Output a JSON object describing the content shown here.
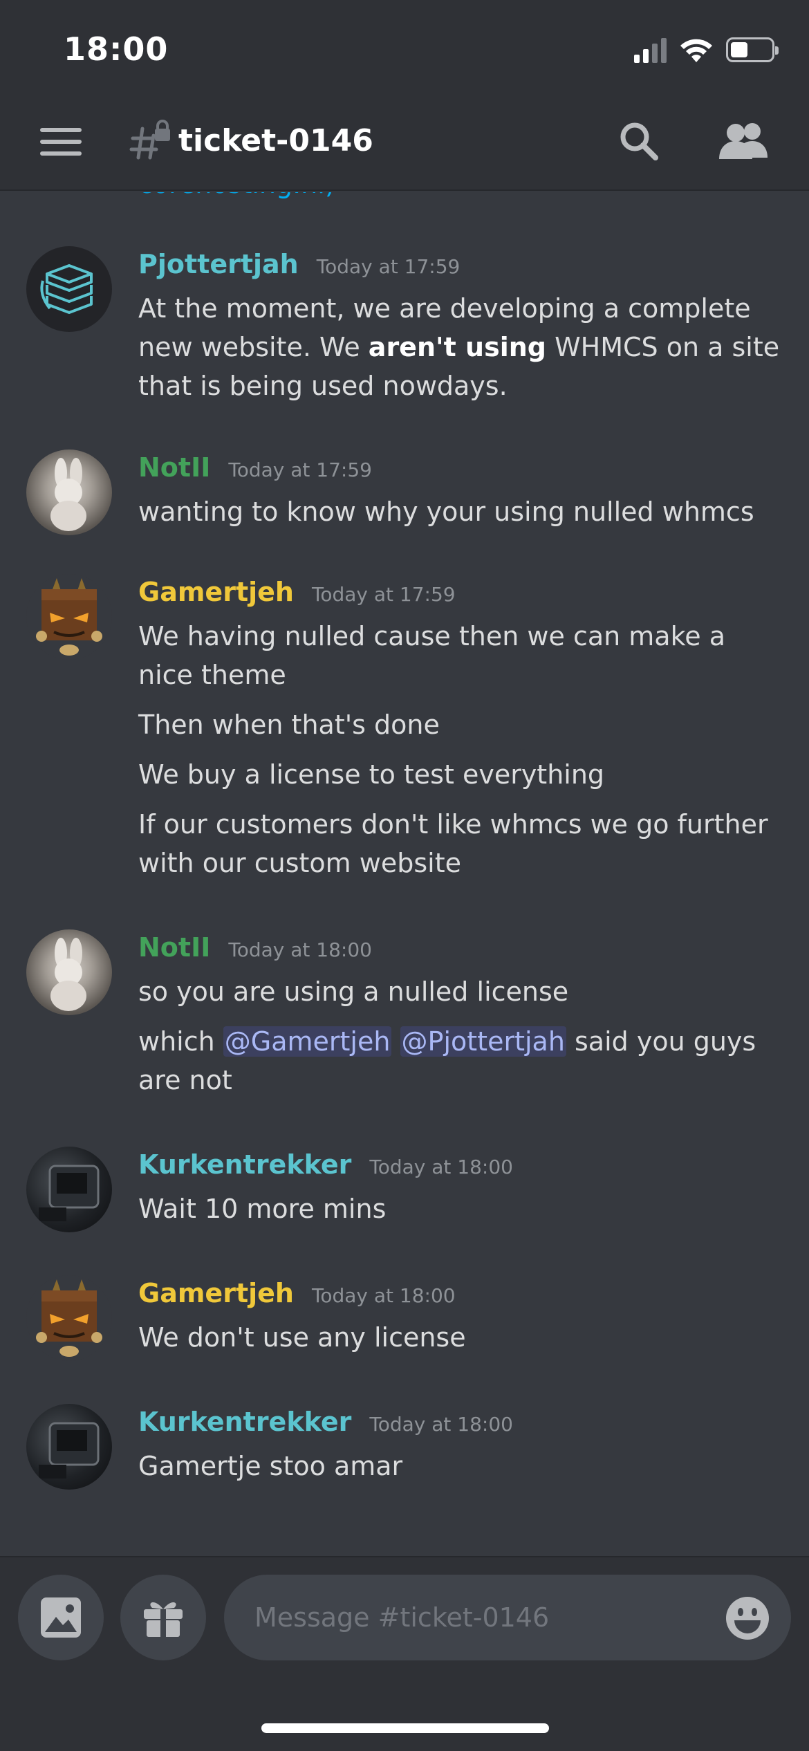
{
  "status_bar": {
    "time": "18:00"
  },
  "header": {
    "channel_name": "ticket-0146"
  },
  "partial_text": "corehosting.nl)",
  "messages": [
    {
      "username": "Pjottertjah",
      "timestamp": "Today at 17:59",
      "color": "#5bc4cf",
      "line1_a": "At the moment, we are developing a complete new website. We ",
      "line1_bold": "aren't using",
      "line1_b": " WHMCS on a site that is being used nowdays."
    },
    {
      "username": "NotII",
      "timestamp": "Today at 17:59",
      "color": "#43a25a",
      "lines": [
        "wanting to know why your using nulled whmcs"
      ]
    },
    {
      "username": "Gamertjeh",
      "timestamp": "Today at 17:59",
      "color": "#f0c83a",
      "lines": [
        "We having nulled cause then we can make a nice theme",
        "Then when that's done",
        "We buy a license to test everything",
        "If our customers don't like whmcs we go further with our custom website"
      ]
    },
    {
      "username": "NotII",
      "timestamp": "Today at 18:00",
      "color": "#43a25a",
      "line1": "so you are using a nulled license",
      "line2_a": "which ",
      "mention1": "@Gamertjeh",
      "mention2": "@Pjottertjah",
      "line2_b": " said you guys are not"
    },
    {
      "username": "Kurkentrekker",
      "timestamp": "Today at 18:00",
      "color": "#5bc4cf",
      "lines": [
        "Wait 10 more mins"
      ]
    },
    {
      "username": "Gamertjeh",
      "timestamp": "Today at 18:00",
      "color": "#f0c83a",
      "lines": [
        "We don't use any license"
      ]
    },
    {
      "username": "Kurkentrekker",
      "timestamp": "Today at 18:00",
      "color": "#5bc4cf",
      "lines": [
        "Gamertje stoo amar"
      ]
    }
  ],
  "composer": {
    "placeholder": "Message #ticket-0146"
  }
}
